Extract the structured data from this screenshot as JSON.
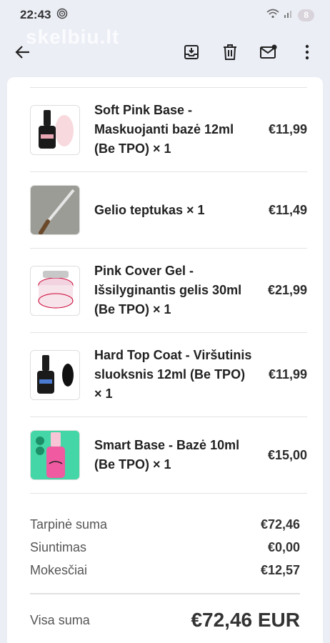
{
  "status": {
    "time": "22:43",
    "battery": "8"
  },
  "watermark": "skelbiu.lt",
  "toolbar": {
    "icons": [
      "back-arrow-icon",
      "archive-icon",
      "delete-icon",
      "mark-unread-icon",
      "more-vert-icon"
    ]
  },
  "items": [
    {
      "name": "Soft Pink Base - Maskuojanti bazė 12ml (Be TPO) × 1",
      "price": "€11,99",
      "thumb": "bottle-pink"
    },
    {
      "name": "Gelio teptukas × 1",
      "price": "€11,49",
      "thumb": "brush"
    },
    {
      "name": "Pink Cover Gel - Išsilyginantis gelis 30ml (Be TPO) × 1",
      "price": "€21,99",
      "thumb": "jar"
    },
    {
      "name": "Hard Top Coat - Viršutinis sluoksnis 12ml (Be TPO) × 1",
      "price": "€11,99",
      "thumb": "bottle-black"
    },
    {
      "name": "Smart Base - Bazė 10ml (Be TPO) × 1",
      "price": "€15,00",
      "thumb": "bottle-green"
    }
  ],
  "summary": {
    "subtotal_label": "Tarpinė suma",
    "subtotal": "€72,46",
    "shipping_label": "Siuntimas",
    "shipping": "€0,00",
    "taxes_label": "Mokesčiai",
    "taxes": "€12,57"
  },
  "total": {
    "label": "Visa suma",
    "value": "€72,46 EUR"
  }
}
